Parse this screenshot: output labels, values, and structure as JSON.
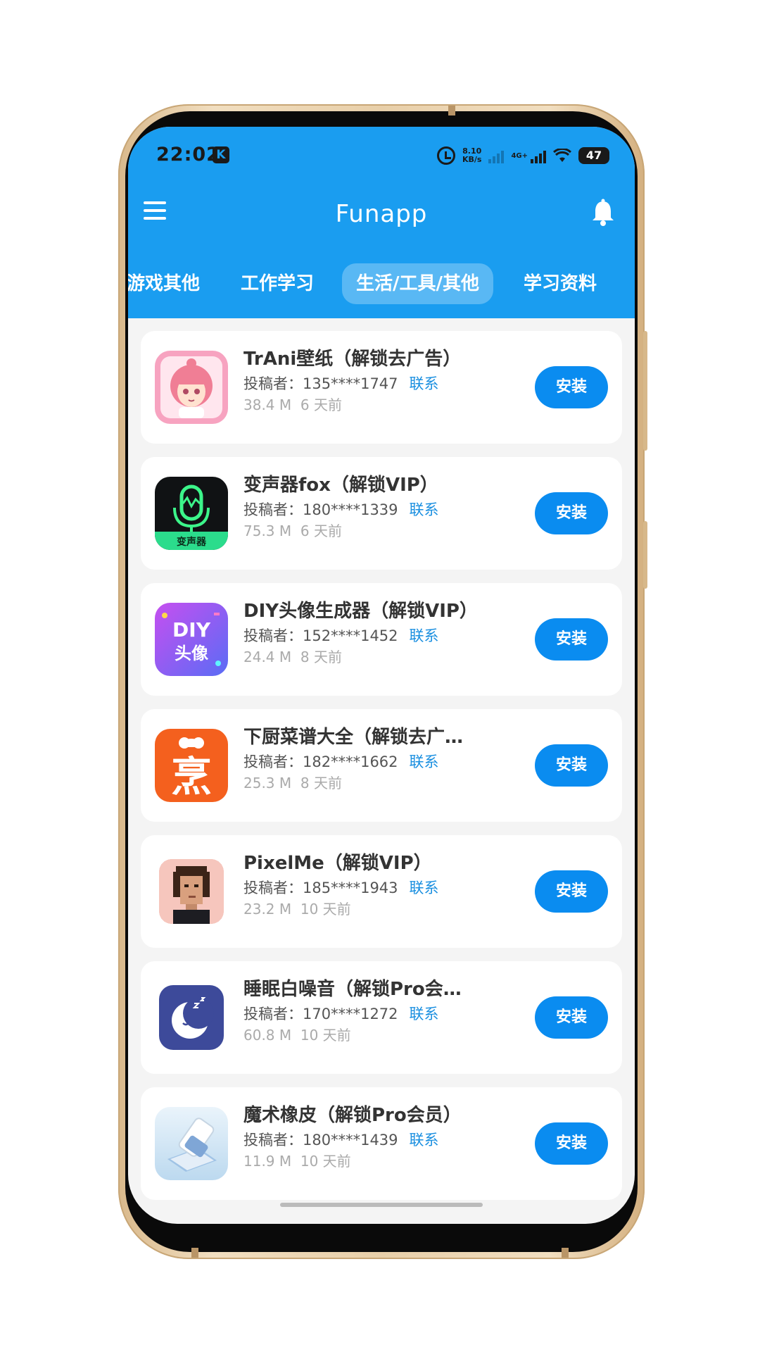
{
  "status_bar": {
    "time": "22:02",
    "k_badge": "K",
    "net_speed_value": "8.10",
    "net_speed_unit": "KB/s",
    "network_type": "4G+",
    "battery": "47"
  },
  "header": {
    "title": "Funapp",
    "accent_color": "#1a9df0",
    "menu_icon": "menu-icon",
    "bell_icon": "bell-icon"
  },
  "tabs": [
    {
      "label": "游戏其他",
      "active": false
    },
    {
      "label": "工作学习",
      "active": false
    },
    {
      "label": "生活/工具/其他",
      "active": true
    },
    {
      "label": "学习资料",
      "active": false
    }
  ],
  "apps": [
    {
      "name": "TrAni壁纸（解锁去广告）",
      "uploader": "投稿者：135****1747",
      "contact": "联系",
      "size": "38.4 M",
      "age": "6 天前",
      "button": "安装",
      "icon": "anime-girl-icon"
    },
    {
      "name": "变声器fox（解锁VIP）",
      "uploader": "投稿者：180****1339",
      "contact": "联系",
      "size": "75.3 M",
      "age": "6 天前",
      "button": "安装",
      "icon": "microphone-icon",
      "icon_label": "变声器"
    },
    {
      "name": "DIY头像生成器（解锁VIP）",
      "uploader": "投稿者：152****1452",
      "contact": "联系",
      "size": "24.4 M",
      "age": "8 天前",
      "button": "安装",
      "icon": "diy-avatar-icon",
      "icon_label_1": "DIY",
      "icon_label_2": "头像"
    },
    {
      "name": "下厨菜谱大全（解锁去广…",
      "uploader": "投稿者：182****1662",
      "contact": "联系",
      "size": "25.3 M",
      "age": "8 天前",
      "button": "安装",
      "icon": "cooking-icon",
      "icon_label": "烹"
    },
    {
      "name": "PixelMe（解锁VIP）",
      "uploader": "投稿者：185****1943",
      "contact": "联系",
      "size": "23.2 M",
      "age": "10 天前",
      "button": "安装",
      "icon": "pixel-portrait-icon"
    },
    {
      "name": "睡眠白噪音（解锁Pro会…",
      "uploader": "投稿者：170****1272",
      "contact": "联系",
      "size": "60.8 M",
      "age": "10 天前",
      "button": "安装",
      "icon": "moon-icon"
    },
    {
      "name": "魔术橡皮（解锁Pro会员）",
      "uploader": "投稿者：180****1439",
      "contact": "联系",
      "size": "11.9 M",
      "age": "10 天前",
      "button": "安装",
      "icon": "eraser-icon"
    }
  ]
}
